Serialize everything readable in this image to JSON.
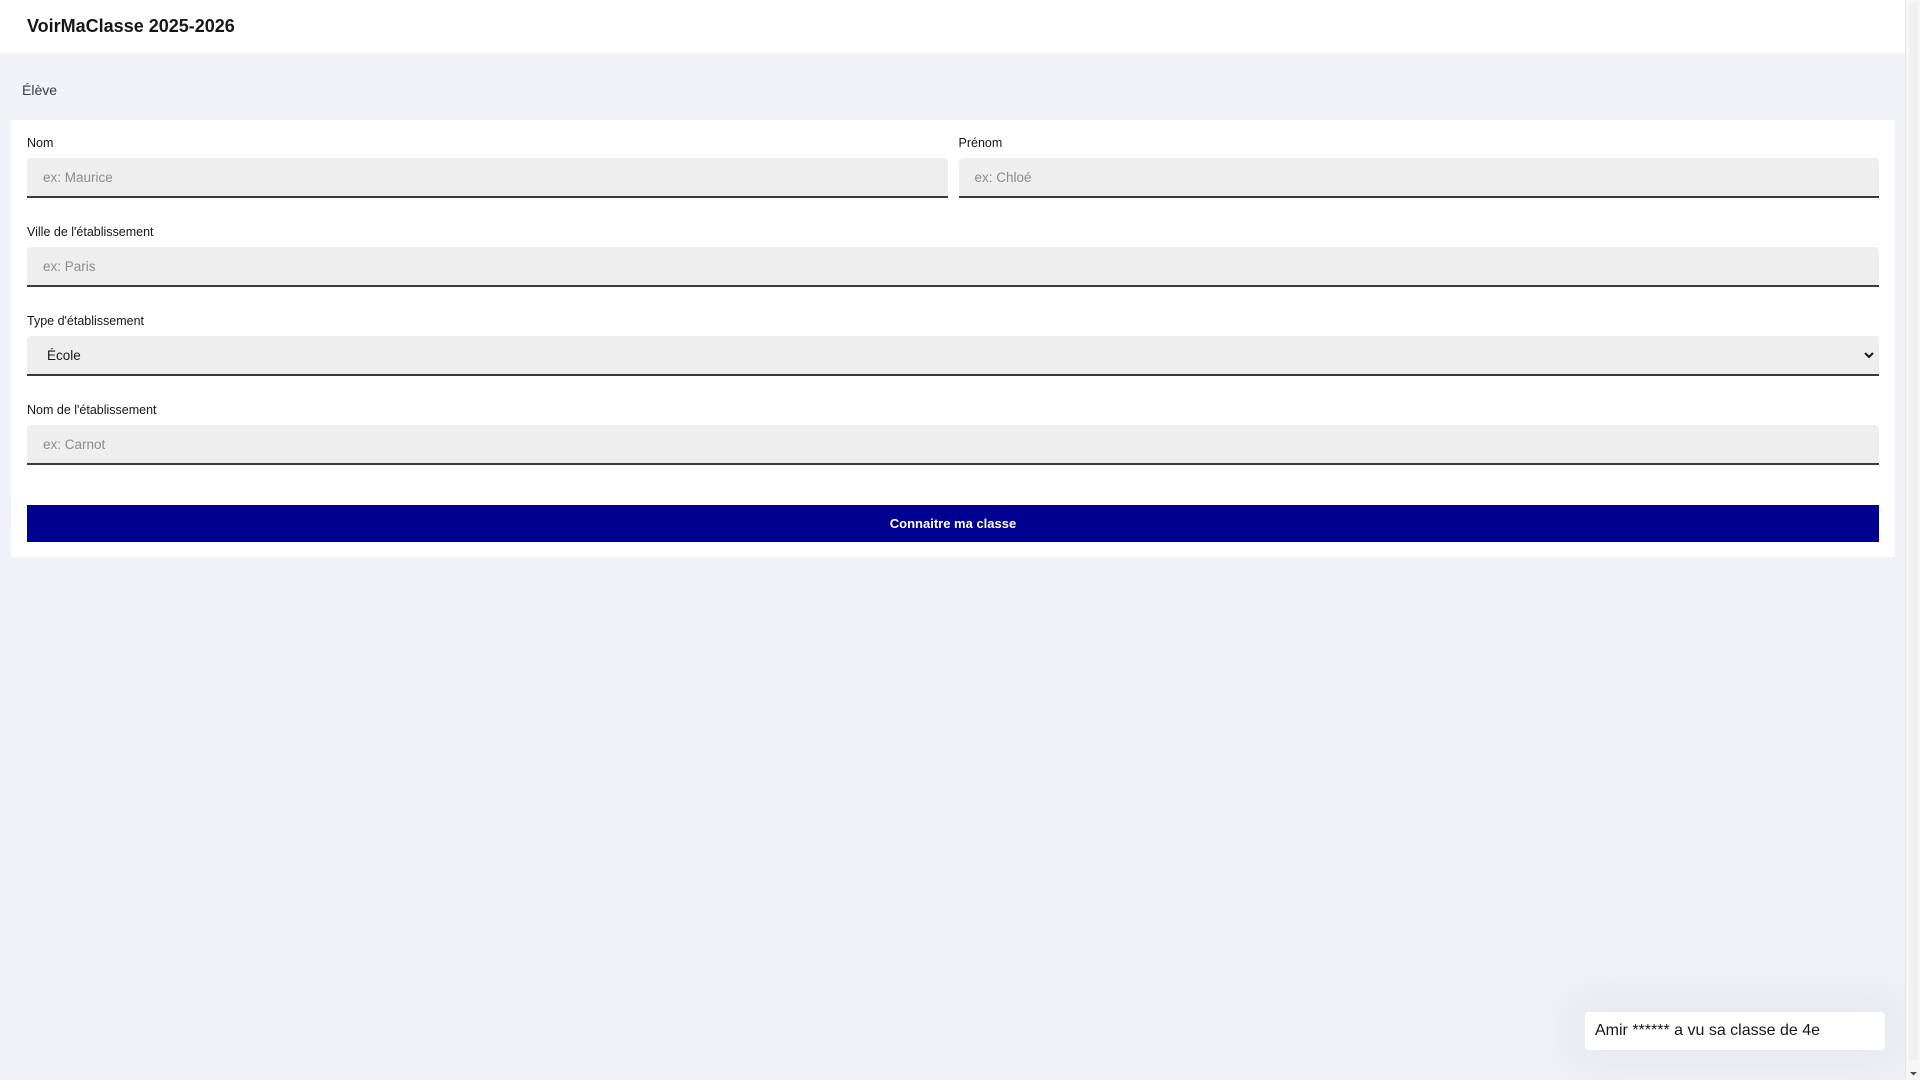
{
  "header": {
    "title": "VoirMaClasse 2025-2026"
  },
  "section": {
    "label": "Élève"
  },
  "form": {
    "nom": {
      "label": "Nom",
      "placeholder": "ex: Maurice",
      "value": ""
    },
    "prenom": {
      "label": "Prénom",
      "placeholder": "ex: Chloé",
      "value": ""
    },
    "ville": {
      "label": "Ville de l'établissement",
      "placeholder": "ex: Paris",
      "value": ""
    },
    "type": {
      "label": "Type d'établissement",
      "selected": "École",
      "icon": "chevron-down-icon"
    },
    "etablissement": {
      "label": "Nom de l'établissement",
      "placeholder": "ex: Carnot",
      "value": ""
    },
    "submit_label": "Connaitre ma classe"
  },
  "toast": {
    "text": "Amir ****** a vu sa classe de 4e"
  },
  "colors": {
    "background": "#f0f2f7",
    "primary": "#000091",
    "input_bg": "#eeeeee"
  }
}
